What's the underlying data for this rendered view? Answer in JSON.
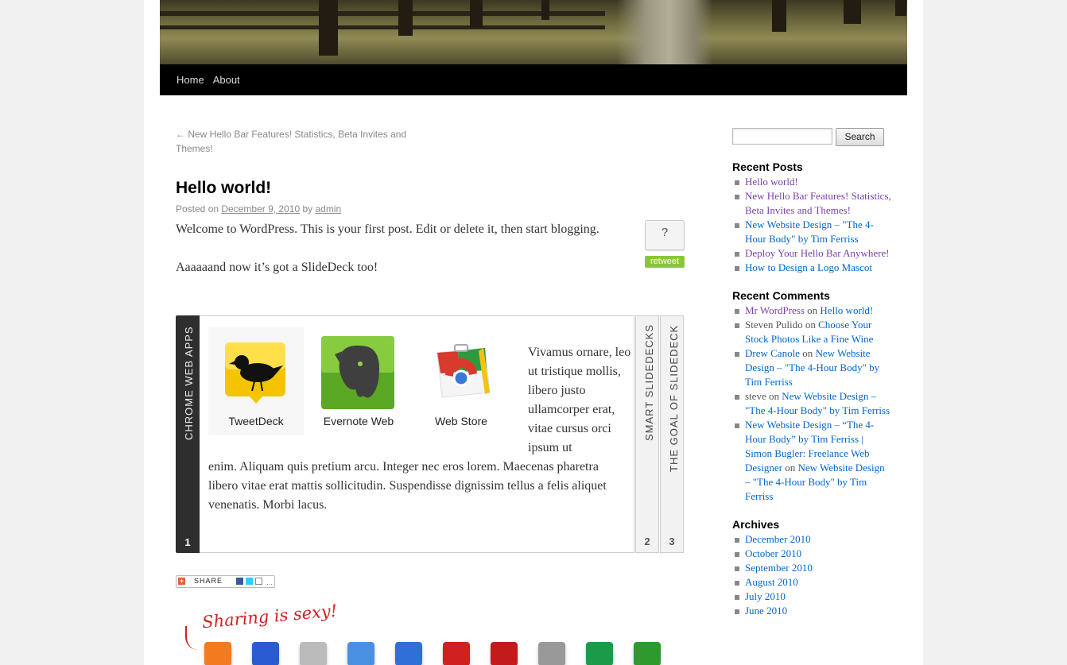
{
  "nav": {
    "items": [
      "Home",
      "About"
    ]
  },
  "post": {
    "prev_link": "← New Hello Bar Features! Statistics, Beta Invites and Themes!",
    "title": "Hello world!",
    "meta_prefix": "Posted on",
    "date": "December 9, 2010",
    "meta_by": "by",
    "author": "admin",
    "para1": "Welcome to WordPress. This is your first post. Edit or delete it, then start blogging.",
    "para2": "Aaaaaand now it’s got a SlideDeck too!",
    "tweet_count": "?",
    "tweet_label": "retweet"
  },
  "slidedeck": {
    "spines": [
      {
        "title": "CHROME WEB APPS",
        "number": "1"
      },
      {
        "title": "SMART SLIDEDECKS",
        "number": "2"
      },
      {
        "title": "THE GOAL OF SLIDEDECK",
        "number": "3"
      }
    ],
    "apps": [
      "TweetDeck",
      "Evernote Web",
      "Web Store"
    ],
    "text_side": "Vivamus ornare, leo ut tristique mollis, libero justo ullamcorper erat, vitae cursus orci ipsum ut",
    "text_bottom": "enim. Aliquam quis pretium arcu. Integer nec eros lorem. Maecenas pharetra libero vitae erat mattis sollicitudin. Suspendisse dignissim tellus a felis aliquet venenatis. Morbi lacus."
  },
  "share": {
    "button_label": "SHARE",
    "sexy_label": "Sharing is sexy!",
    "icons": [
      "rss-icon",
      "delicious-icon",
      "digg-icon",
      "myspace-icon",
      "stumbleupon-icon",
      "technorati-icon",
      "mixx-icon",
      "reddit-icon",
      "evernote-icon",
      "friendfeed-icon"
    ],
    "icon_colors": [
      "#f47a20",
      "#2a5bd0",
      "#bbbbbb",
      "#4a90e2",
      "#2f6fd6",
      "#d02020",
      "#c31b1b",
      "#999999",
      "#1c9a4a",
      "#2e9a2e"
    ]
  },
  "sidebar": {
    "search_button": "Search",
    "recent_posts_title": "Recent Posts",
    "recent_posts": [
      "Hello world!",
      "New Hello Bar Features! Statistics, Beta Invites and Themes!",
      "New Website Design – \"The 4-Hour Body\" by Tim Ferriss",
      "Deploy Your Hello Bar Anywhere!",
      "How to Design a Logo Mascot"
    ],
    "recent_comments_title": "Recent Comments",
    "comments": [
      {
        "author": "Mr WordPress",
        "on": "on",
        "post": "Hello world!"
      },
      {
        "author": "Steven Pulido",
        "on": "on",
        "post": "Choose Your Stock Photos Like a Fine Wine"
      },
      {
        "author": "Drew Canole",
        "on": "on",
        "post": "New Website Design – \"The 4-Hour Body\" by Tim Ferriss"
      },
      {
        "author": "steve",
        "on": "on",
        "post": "New Website Design – \"The 4-Hour Body\" by Tim Ferriss"
      },
      {
        "author": "New Website Design – “The 4-Hour Body” by Tim Ferriss | Simon Bugler: Freelance Web Designer",
        "on": "on",
        "post": "New Website Design – \"The 4-Hour Body\" by Tim Ferriss"
      }
    ],
    "archives_title": "Archives",
    "archives": [
      "December 2010",
      "October 2010",
      "September 2010",
      "August 2010",
      "July 2010",
      "June 2010"
    ]
  }
}
